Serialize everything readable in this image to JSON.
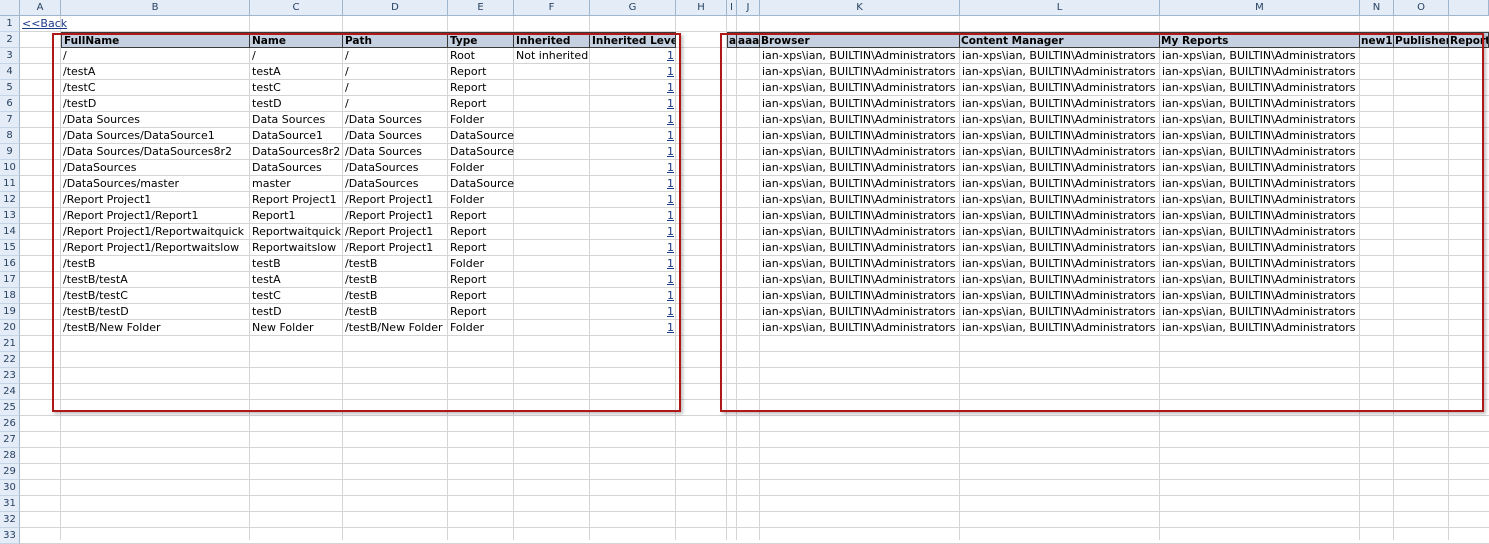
{
  "columns": [
    "A",
    "B",
    "C",
    "D",
    "E",
    "F",
    "G",
    "H",
    "I",
    "J",
    "K",
    "L",
    "M",
    "N",
    "O"
  ],
  "rows": [
    "1",
    "2",
    "3",
    "4",
    "5",
    "6",
    "7",
    "8",
    "9",
    "10",
    "11",
    "12",
    "13",
    "14",
    "15",
    "16",
    "17",
    "18",
    "19",
    "20",
    "21",
    "22",
    "23",
    "24",
    "25",
    "26",
    "27",
    "28",
    "29",
    "30",
    "31",
    "32",
    "33"
  ],
  "back_link": "<<Back",
  "left_headers": [
    "FullName",
    "Name",
    "Path",
    "Type",
    "Inherited",
    "Inherited Level"
  ],
  "right_headers": [
    "a",
    "aaa",
    "Browser",
    "Content Manager",
    "My Reports",
    "new1",
    "Publisher",
    "Report"
  ],
  "left_rows": [
    [
      "/",
      "/",
      "/",
      "Root",
      "Not inherited",
      "1"
    ],
    [
      "/testA",
      "testA",
      "/",
      "Report",
      "",
      "1"
    ],
    [
      "/testC",
      "testC",
      "/",
      "Report",
      "",
      "1"
    ],
    [
      "/testD",
      "testD",
      "/",
      "Report",
      "",
      "1"
    ],
    [
      "/Data Sources",
      "Data Sources",
      "/Data Sources",
      "Folder",
      "",
      "1"
    ],
    [
      "/Data Sources/DataSource1",
      "DataSource1",
      "/Data Sources",
      "DataSource",
      "",
      "1"
    ],
    [
      "/Data Sources/DataSources8r2",
      "DataSources8r2",
      "/Data Sources",
      "DataSource",
      "",
      "1"
    ],
    [
      "/DataSources",
      "DataSources",
      "/DataSources",
      "Folder",
      "",
      "1"
    ],
    [
      "/DataSources/master",
      "master",
      "/DataSources",
      "DataSource",
      "",
      "1"
    ],
    [
      "/Report Project1",
      "Report Project1",
      "/Report Project1",
      "Folder",
      "",
      "1"
    ],
    [
      "/Report Project1/Report1",
      "Report1",
      "/Report Project1",
      "Report",
      "",
      "1"
    ],
    [
      "/Report Project1/Reportwaitquick",
      "Reportwaitquick",
      "/Report Project1",
      "Report",
      "",
      "1"
    ],
    [
      "/Report Project1/Reportwaitslow",
      "Reportwaitslow",
      "/Report Project1",
      "Report",
      "",
      "1"
    ],
    [
      "/testB",
      "testB",
      "/testB",
      "Folder",
      "",
      "1"
    ],
    [
      "/testB/testA",
      "testA",
      "/testB",
      "Report",
      "",
      "1"
    ],
    [
      "/testB/testC",
      "testC",
      "/testB",
      "Report",
      "",
      "1"
    ],
    [
      "/testB/testD",
      "testD",
      "/testB",
      "Report",
      "",
      "1"
    ],
    [
      "/testB/New Folder",
      "New Folder",
      "/testB/New Folder",
      "Folder",
      "",
      "1"
    ]
  ],
  "perm_value": "ian-xps\\ian, BUILTIN\\Administrators"
}
